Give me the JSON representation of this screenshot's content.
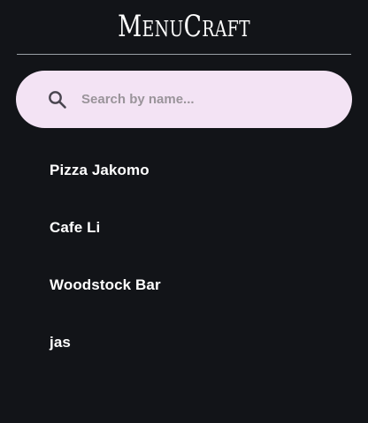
{
  "app": {
    "title": "MenuCraft"
  },
  "search": {
    "placeholder": "Search by name...",
    "value": "",
    "icon": "search-icon"
  },
  "restaurants": [
    {
      "name": "Pizza Jakomo"
    },
    {
      "name": "Cafe Li"
    },
    {
      "name": "Woodstock Bar"
    },
    {
      "name": "jas"
    }
  ],
  "colors": {
    "background": "#121418",
    "search_background": "#f3e3f4",
    "text": "#ffffff",
    "placeholder": "#9a949a",
    "divider": "#9aa0a6"
  }
}
